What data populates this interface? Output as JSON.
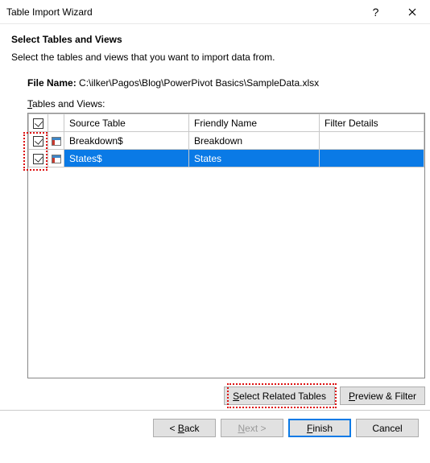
{
  "window": {
    "title": "Table Import Wizard"
  },
  "page": {
    "heading": "Select Tables and Views",
    "subheading": "Select the tables and views that you want to import data from."
  },
  "file": {
    "label": "File Name:",
    "path": "C:\\ilker\\Pagos\\Blog\\PowerPivot Basics\\SampleData.xlsx"
  },
  "tv": {
    "label": "Tables and Views:"
  },
  "columns": {
    "source": "Source Table",
    "friendly": "Friendly Name",
    "filter": "Filter Details"
  },
  "rows": [
    {
      "checked": true,
      "source": "Breakdown$",
      "friendly": "Breakdown",
      "filter": "",
      "selected": false
    },
    {
      "checked": true,
      "source": "States$",
      "friendly": "States",
      "filter": "",
      "selected": true
    }
  ],
  "buttons": {
    "select_related": "Select Related Tables",
    "preview_filter": "Preview & Filter",
    "back": "< Back",
    "next": "Next >",
    "finish": "Finish",
    "cancel": "Cancel"
  }
}
